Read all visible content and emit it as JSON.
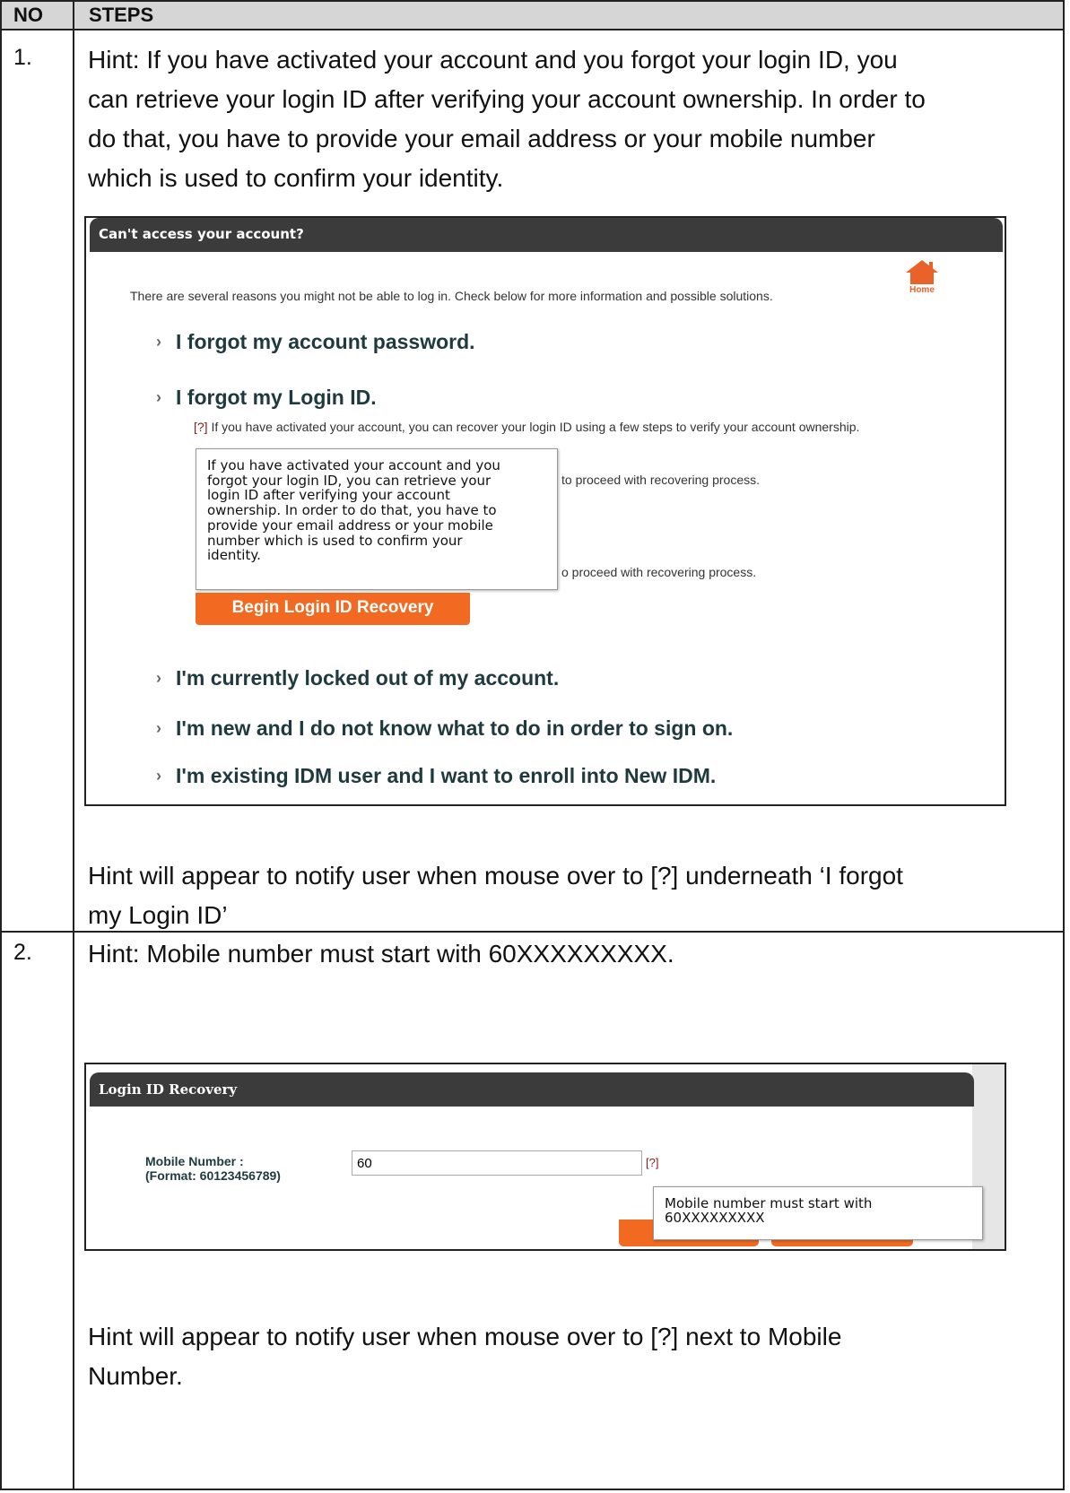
{
  "header": {
    "no": "NO",
    "steps": "STEPS"
  },
  "step1": {
    "number": "1.",
    "hint_lines": [
      "Hint: If you have activated your account and you forgot your login ID, you",
      "can retrieve your login ID after verifying your account ownership. In order to",
      "do that, you have to provide your email address or your mobile number",
      "which is used to confirm your identity."
    ],
    "screenshot": {
      "title": "Can't access your account?",
      "home_label": "Home",
      "intro": "There are several reasons you might not be able to log in. Check below for more information and possible solutions.",
      "options": [
        "I forgot my account password.",
        "I forgot my Login ID.",
        "I'm currently locked out of my account.",
        "I'm new and I do not know what to do in order to sign on.",
        "I'm existing IDM user and I want to enroll into New IDM."
      ],
      "q_mark": "[?]",
      "q_text": " If you have activated your account, you can recover your login ID using a few steps to verify your account ownership.",
      "behind_text_1": "to proceed with recovering process.",
      "behind_text_2": "o proceed with recovering process.",
      "tooltip_lines": [
        "If you have activated your account and you",
        "forgot your login ID, you can retrieve your",
        "login ID after verifying your account",
        "ownership. In order to do that, you have to",
        "provide your email address or your mobile",
        "number which is used to confirm your",
        "identity."
      ],
      "button": "Begin Login ID Recovery"
    },
    "note_lines": [
      "Hint will appear to notify user when mouse over to [?] underneath ‘I forgot",
      "my Login ID’"
    ]
  },
  "step2": {
    "number": "2.",
    "hint": "Hint: Mobile number must start with 60XXXXXXXXX.",
    "screenshot": {
      "title": "Login ID Recovery",
      "label_line1": "Mobile Number :",
      "label_line2": "(Format: 60123456789)",
      "input_value": "60",
      "q_mark": "[?]",
      "tooltip_lines": [
        "Mobile number must start with",
        "60XXXXXXXXX"
      ]
    },
    "note_lines": [
      "Hint will appear to notify user when mouse over to [?] next to Mobile",
      "Number."
    ]
  },
  "colors": {
    "accent_orange": "#f26a21",
    "title_bar": "#3b3b3b",
    "header_grey": "#d6d6d6",
    "link_dark_red": "#8b1a1a"
  }
}
